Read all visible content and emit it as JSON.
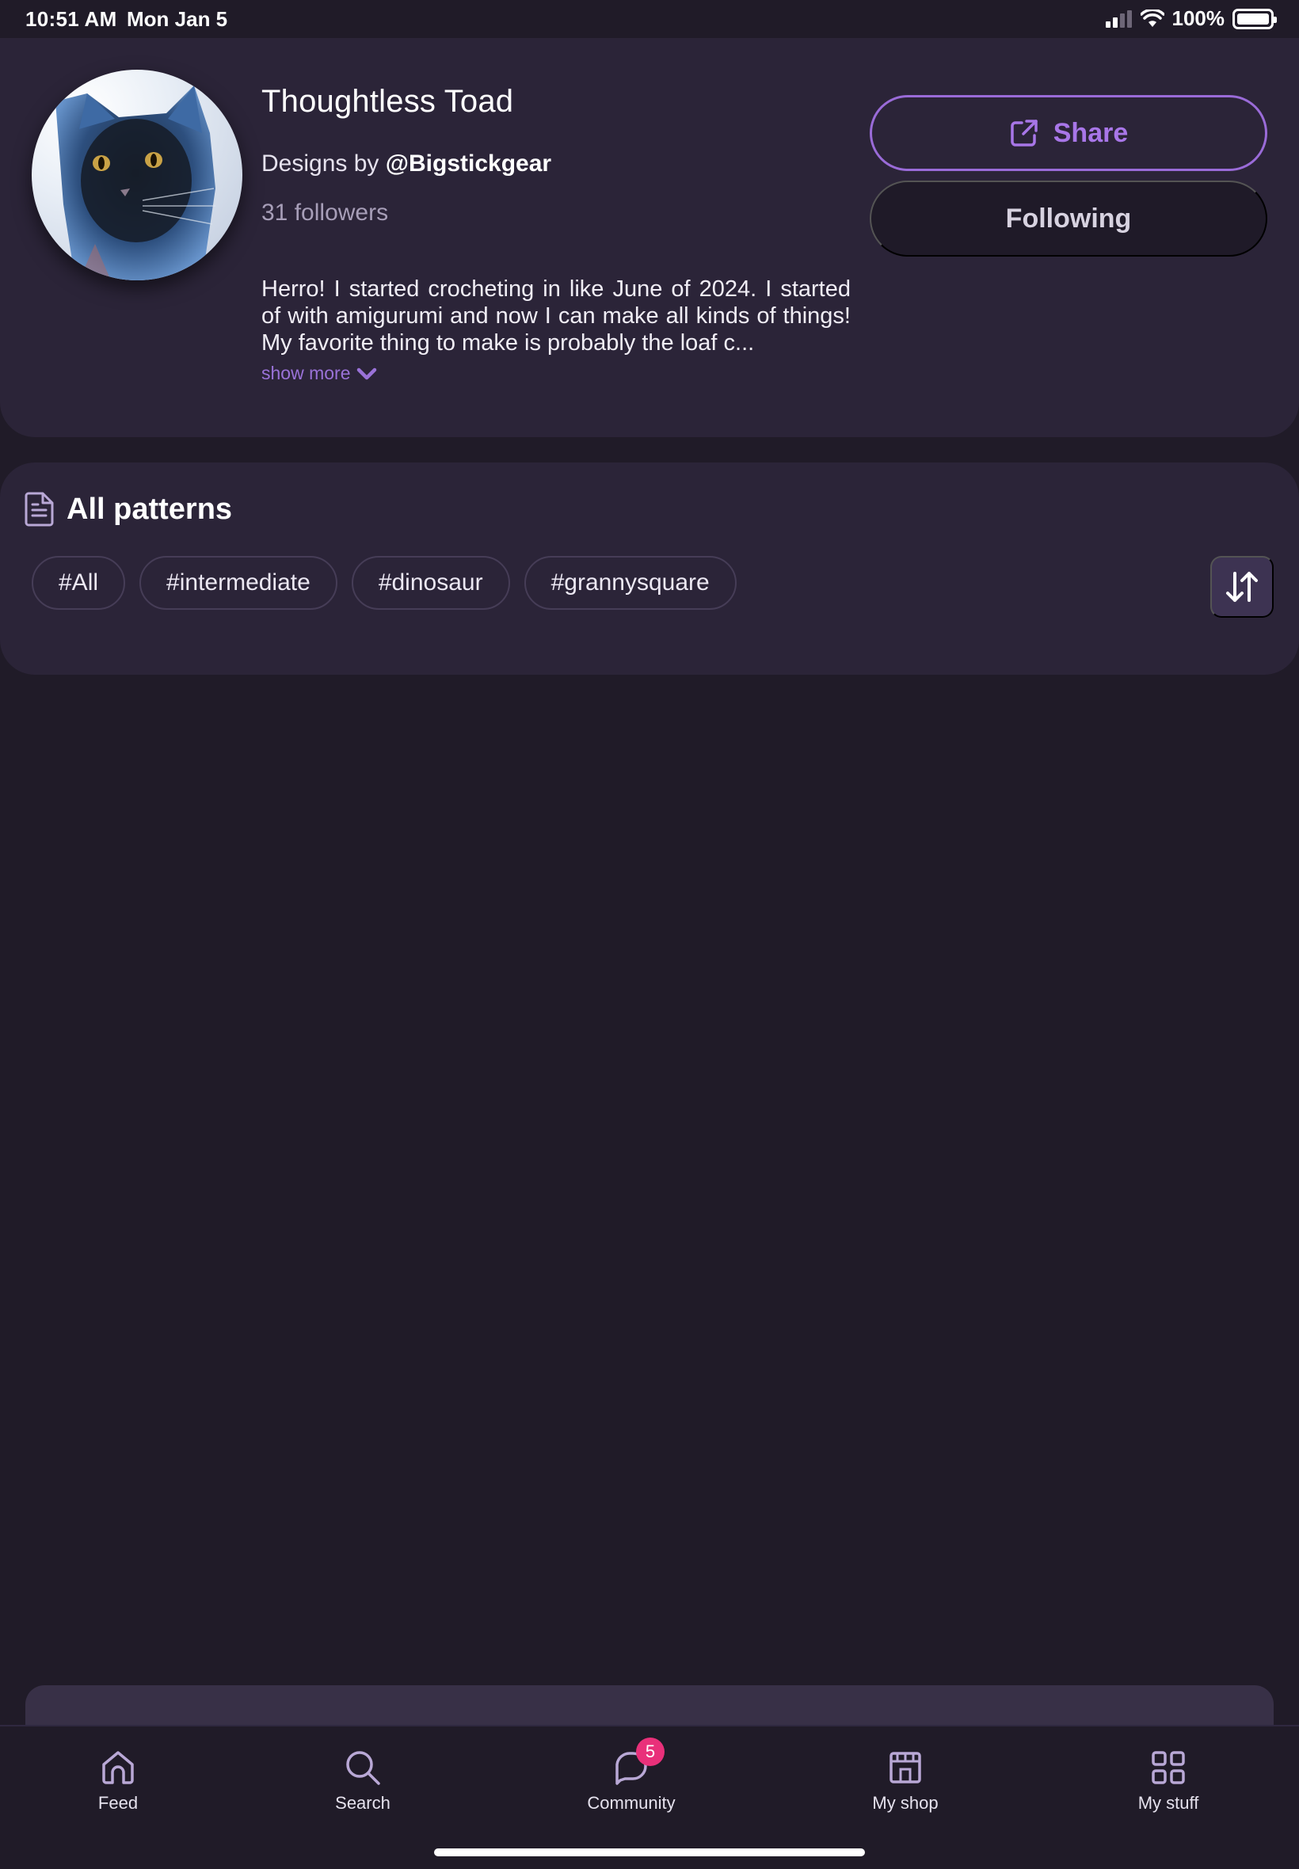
{
  "status_bar": {
    "time": "10:51 AM",
    "date": "Mon Jan 5",
    "battery": "100%",
    "battery_level": 1.0
  },
  "profile": {
    "name": "Thoughtless Toad",
    "designs_by_prefix": "Designs by",
    "handle": "@Bigstickgear",
    "followers_count": "31",
    "followers_label": "followers",
    "bio": "Herro! I started crocheting in like June of 2024. I started of with amigurumi and now I can make all kinds of things! My favorite thing to make is probably the loaf c...",
    "show_more": "show more",
    "avatar_icon": "cat-photo-avatar"
  },
  "actions": {
    "share": "Share",
    "following": "Following"
  },
  "patterns": {
    "title": "All patterns",
    "tags": [
      "#All",
      "#intermediate",
      "#dinosaur",
      "#grannysquare"
    ]
  },
  "tabbar": {
    "items": [
      {
        "label": "Feed",
        "icon": "home-icon"
      },
      {
        "label": "Search",
        "icon": "search-icon"
      },
      {
        "label": "Community",
        "icon": "chat-icon",
        "badge": "5"
      },
      {
        "label": "My shop",
        "icon": "shop-icon"
      },
      {
        "label": "My stuff",
        "icon": "grid-icon"
      }
    ]
  },
  "colors": {
    "background": "#201b28",
    "card": "#2b2438",
    "accent": "#a876e8",
    "badge": "#e9307a"
  }
}
